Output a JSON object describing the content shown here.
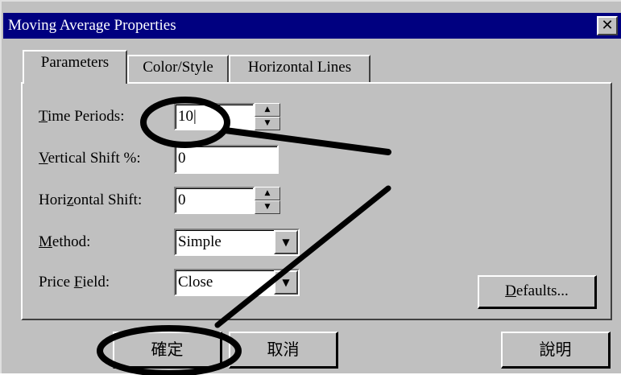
{
  "window": {
    "title": "Moving Average Properties",
    "close_glyph": "✕"
  },
  "tabs": [
    {
      "label": "Parameters",
      "active": true
    },
    {
      "label": "Color/Style",
      "active": false
    },
    {
      "label": "Horizontal Lines",
      "active": false
    }
  ],
  "form": {
    "time_periods": {
      "label_mnemonic": "T",
      "label_rest": "ime Periods:",
      "value": "10|"
    },
    "vertical_shift": {
      "label_mnemonic": "V",
      "label_rest": "ertical Shift %:",
      "value": "0"
    },
    "horizontal_shift": {
      "label_pre": "Hori",
      "label_mnemonic": "z",
      "label_rest": "ontal Shift:",
      "value": "0"
    },
    "method": {
      "label_mnemonic": "M",
      "label_rest": "ethod:",
      "value": "Simple"
    },
    "price_field": {
      "label_pre": "Price ",
      "label_mnemonic": "F",
      "label_rest": "ield:",
      "value": "Close"
    }
  },
  "buttons": {
    "defaults_mnemonic": "D",
    "defaults_rest": "efaults...",
    "ok": "確定",
    "cancel": "取消",
    "help": "說明"
  },
  "icons": {
    "spin_up": "▲",
    "spin_down": "▼",
    "dropdown": "▼"
  }
}
